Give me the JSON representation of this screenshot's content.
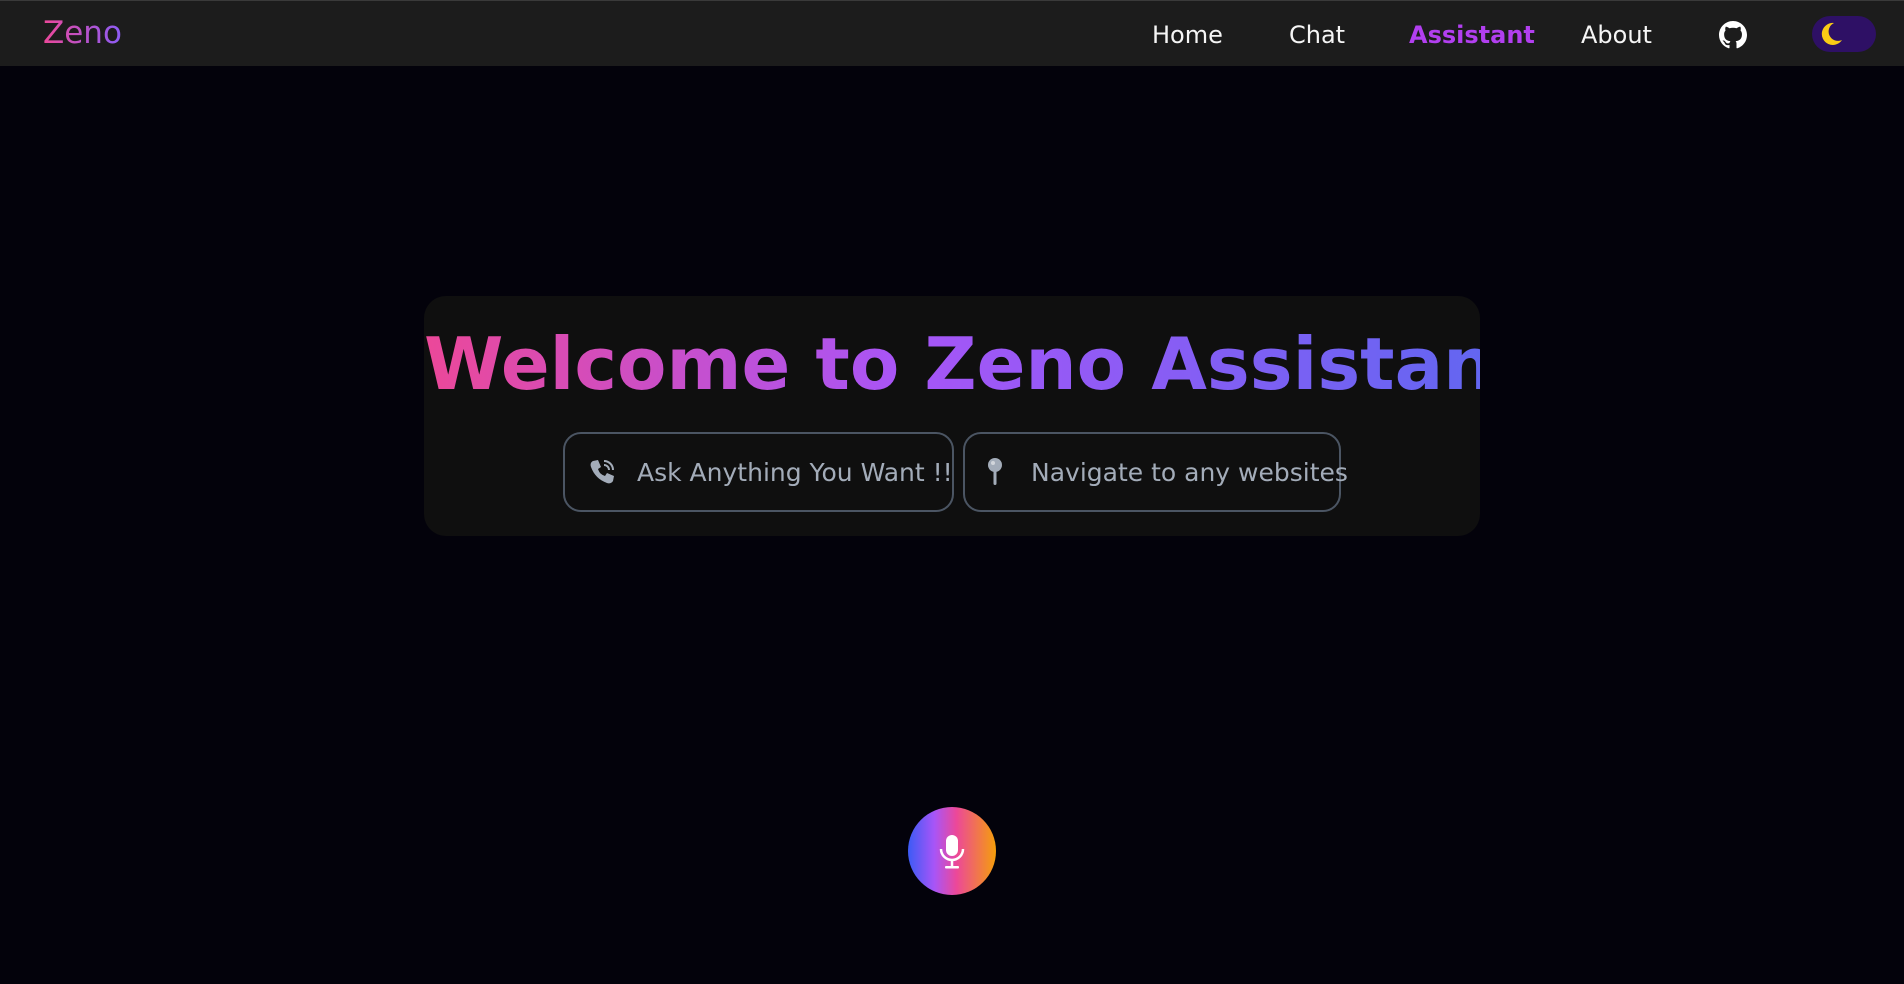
{
  "navbar": {
    "logo": "Zeno",
    "links": [
      {
        "label": "Home",
        "active": false
      },
      {
        "label": "Chat",
        "active": false
      },
      {
        "label": "Assistant",
        "active": true
      },
      {
        "label": "About",
        "active": false
      }
    ],
    "github_icon": "github-icon",
    "theme_toggle_icon": "moon-icon"
  },
  "hero": {
    "title": "Welcome to Zeno Assistant",
    "features": [
      {
        "icon": "phone-icon",
        "label": "Ask Anything You Want !!"
      },
      {
        "icon": "pin-icon",
        "label": "Navigate to any websites"
      }
    ]
  },
  "mic": {
    "icon": "microphone-icon"
  },
  "colors": {
    "background": "#03020b",
    "navbar": "#1c1c1c",
    "accent_active": "#b23ff0",
    "gradient_start": "#ec4899",
    "gradient_mid": "#a855f7",
    "gradient_end": "#6366f1",
    "toggle_bg": "#2e1065",
    "moon": "#facc15"
  }
}
